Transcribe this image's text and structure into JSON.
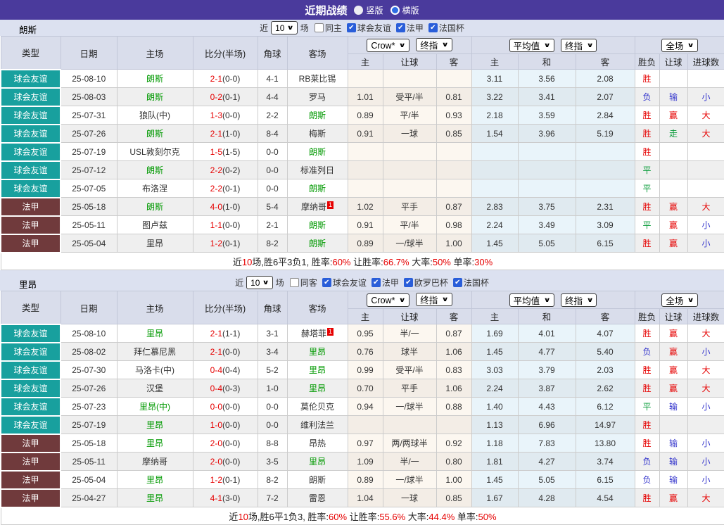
{
  "title_bar": {
    "title": "近期战绩",
    "radios": [
      {
        "label": "竖版",
        "checked": false
      },
      {
        "label": "横版",
        "checked": true
      }
    ]
  },
  "colors": {
    "titlebar_bg": "#4a3a9c",
    "friendly_badge_bg": "#18a09e",
    "league_badge_bg": "#703a3c",
    "self_team_green": "#009900",
    "score_red": "#e60000",
    "win_red": "#e60000",
    "draw_green": "#009933",
    "lose_blue": "#3334cc",
    "checkbox_blue": "#2a5ed9",
    "header_bg": "#d9ddeb",
    "avg_col_bg": "#e9f4fa",
    "odds_col_bg": "#fcf7f0"
  },
  "table_header": {
    "cols": [
      "类型",
      "日期",
      "主场",
      "比分(半场)",
      "角球",
      "客场"
    ],
    "odds_group": {
      "select1": "Crow*",
      "select2": "终指",
      "cols": [
        "主",
        "让球",
        "客"
      ]
    },
    "avg_group": {
      "select1": "平均值",
      "select2": "终指",
      "cols": [
        "主",
        "和",
        "客"
      ]
    },
    "result_group": {
      "select": "全场",
      "cols": [
        "胜负",
        "让球",
        "进球数"
      ]
    }
  },
  "sections": [
    {
      "team": "朗斯",
      "filter": {
        "near_label": "近",
        "matches": "10",
        "games_label": "场",
        "checkboxes": [
          {
            "label": "同主",
            "checked": false
          },
          {
            "label": "球会友谊",
            "checked": true
          },
          {
            "label": "法甲",
            "checked": true
          },
          {
            "label": "法国杯",
            "checked": true
          }
        ]
      },
      "rows": [
        {
          "type": "球会友谊",
          "style": "friendly",
          "date": "25-08-10",
          "home": "朗斯",
          "home_self": true,
          "home_sup": "",
          "score": "2-1",
          "half": "(0-0)",
          "corner": "4-1",
          "away": "RB莱比锡",
          "away_self": false,
          "away_sup": "",
          "odds": [
            "",
            "",
            ""
          ],
          "avg": [
            "3.11",
            "3.56",
            "2.08"
          ],
          "res": [
            {
              "t": "胜",
              "c": "red"
            },
            {
              "t": "",
              "c": ""
            },
            {
              "t": "",
              "c": ""
            }
          ]
        },
        {
          "type": "球会友谊",
          "style": "friendly",
          "date": "25-08-03",
          "home": "朗斯",
          "home_self": true,
          "home_sup": "",
          "score": "0-2",
          "half": "(0-1)",
          "corner": "4-4",
          "away": "罗马",
          "away_self": false,
          "away_sup": "",
          "odds": [
            "1.01",
            "受平/半",
            "0.81"
          ],
          "avg": [
            "3.22",
            "3.41",
            "2.07"
          ],
          "res": [
            {
              "t": "负",
              "c": "blue"
            },
            {
              "t": "输",
              "c": "blue"
            },
            {
              "t": "小",
              "c": "blue"
            }
          ]
        },
        {
          "type": "球会友谊",
          "style": "friendly",
          "date": "25-07-31",
          "home": "狼队(中)",
          "home_self": false,
          "home_sup": "",
          "score": "1-3",
          "half": "(0-0)",
          "corner": "2-2",
          "away": "朗斯",
          "away_self": true,
          "away_sup": "",
          "odds": [
            "0.89",
            "平/半",
            "0.93"
          ],
          "avg": [
            "2.18",
            "3.59",
            "2.84"
          ],
          "res": [
            {
              "t": "胜",
              "c": "red"
            },
            {
              "t": "赢",
              "c": "red"
            },
            {
              "t": "大",
              "c": "red"
            }
          ]
        },
        {
          "type": "球会友谊",
          "style": "friendly",
          "date": "25-07-26",
          "home": "朗斯",
          "home_self": true,
          "home_sup": "",
          "score": "2-1",
          "half": "(1-0)",
          "corner": "8-4",
          "away": "梅斯",
          "away_self": false,
          "away_sup": "",
          "odds": [
            "0.91",
            "一球",
            "0.85"
          ],
          "avg": [
            "1.54",
            "3.96",
            "5.19"
          ],
          "res": [
            {
              "t": "胜",
              "c": "red"
            },
            {
              "t": "走",
              "c": "green"
            },
            {
              "t": "大",
              "c": "red"
            }
          ]
        },
        {
          "type": "球会友谊",
          "style": "friendly",
          "date": "25-07-19",
          "home": "USL敦刻尔克",
          "home_self": false,
          "home_sup": "",
          "score": "1-5",
          "half": "(1-5)",
          "corner": "0-0",
          "away": "朗斯",
          "away_self": true,
          "away_sup": "",
          "odds": [
            "",
            "",
            ""
          ],
          "avg": [
            "",
            "",
            ""
          ],
          "res": [
            {
              "t": "胜",
              "c": "red"
            },
            {
              "t": "",
              "c": ""
            },
            {
              "t": "",
              "c": ""
            }
          ]
        },
        {
          "type": "球会友谊",
          "style": "friendly",
          "date": "25-07-12",
          "home": "朗斯",
          "home_self": true,
          "home_sup": "",
          "score": "2-2",
          "half": "(0-2)",
          "corner": "0-0",
          "away": "标准列日",
          "away_self": false,
          "away_sup": "",
          "odds": [
            "",
            "",
            ""
          ],
          "avg": [
            "",
            "",
            ""
          ],
          "res": [
            {
              "t": "平",
              "c": "green"
            },
            {
              "t": "",
              "c": ""
            },
            {
              "t": "",
              "c": ""
            }
          ]
        },
        {
          "type": "球会友谊",
          "style": "friendly",
          "date": "25-07-05",
          "home": "布洛涅",
          "home_self": false,
          "home_sup": "",
          "score": "2-2",
          "half": "(0-1)",
          "corner": "0-0",
          "away": "朗斯",
          "away_self": true,
          "away_sup": "",
          "odds": [
            "",
            "",
            ""
          ],
          "avg": [
            "",
            "",
            ""
          ],
          "res": [
            {
              "t": "平",
              "c": "green"
            },
            {
              "t": "",
              "c": ""
            },
            {
              "t": "",
              "c": ""
            }
          ]
        },
        {
          "type": "法甲",
          "style": "league",
          "date": "25-05-18",
          "home": "朗斯",
          "home_self": true,
          "home_sup": "",
          "score": "4-0",
          "half": "(1-0)",
          "corner": "5-4",
          "away": "摩纳哥",
          "away_self": false,
          "away_sup": "1",
          "odds": [
            "1.02",
            "平手",
            "0.87"
          ],
          "avg": [
            "2.83",
            "3.75",
            "2.31"
          ],
          "res": [
            {
              "t": "胜",
              "c": "red"
            },
            {
              "t": "赢",
              "c": "red"
            },
            {
              "t": "大",
              "c": "red"
            }
          ]
        },
        {
          "type": "法甲",
          "style": "league",
          "date": "25-05-11",
          "home": "图卢兹",
          "home_self": false,
          "home_sup": "",
          "score": "1-1",
          "half": "(0-0)",
          "corner": "2-1",
          "away": "朗斯",
          "away_self": true,
          "away_sup": "",
          "odds": [
            "0.91",
            "平/半",
            "0.98"
          ],
          "avg": [
            "2.24",
            "3.49",
            "3.09"
          ],
          "res": [
            {
              "t": "平",
              "c": "green"
            },
            {
              "t": "赢",
              "c": "red"
            },
            {
              "t": "小",
              "c": "blue"
            }
          ]
        },
        {
          "type": "法甲",
          "style": "league",
          "date": "25-05-04",
          "home": "里昂",
          "home_self": false,
          "home_sup": "",
          "score": "1-2",
          "half": "(0-1)",
          "corner": "8-2",
          "away": "朗斯",
          "away_self": true,
          "away_sup": "",
          "odds": [
            "0.89",
            "一/球半",
            "1.00"
          ],
          "avg": [
            "1.45",
            "5.05",
            "6.15"
          ],
          "res": [
            {
              "t": "胜",
              "c": "red"
            },
            {
              "t": "赢",
              "c": "red"
            },
            {
              "t": "小",
              "c": "blue"
            }
          ]
        }
      ],
      "summary": {
        "segments": [
          {
            "text": "近",
            "red": false
          },
          {
            "text": "10",
            "red": true
          },
          {
            "text": "场,胜6平3负1, 胜率:",
            "red": false
          },
          {
            "text": "60%",
            "red": true
          },
          {
            "text": " 让胜率:",
            "red": false
          },
          {
            "text": "66.7%",
            "red": true
          },
          {
            "text": " 大率:",
            "red": false
          },
          {
            "text": "50%",
            "red": true
          },
          {
            "text": " 单率:",
            "red": false
          },
          {
            "text": "30%",
            "red": true
          }
        ]
      }
    },
    {
      "team": "里昂",
      "filter": {
        "near_label": "近",
        "matches": "10",
        "games_label": "场",
        "checkboxes": [
          {
            "label": "同客",
            "checked": false
          },
          {
            "label": "球会友谊",
            "checked": true
          },
          {
            "label": "法甲",
            "checked": true
          },
          {
            "label": "欧罗巴杯",
            "checked": true
          },
          {
            "label": "法国杯",
            "checked": true
          }
        ]
      },
      "rows": [
        {
          "type": "球会友谊",
          "style": "friendly",
          "date": "25-08-10",
          "home": "里昂",
          "home_self": true,
          "home_sup": "",
          "score": "2-1",
          "half": "(1-1)",
          "corner": "3-1",
          "away": "赫塔菲",
          "away_self": false,
          "away_sup": "1",
          "odds": [
            "0.95",
            "半/一",
            "0.87"
          ],
          "avg": [
            "1.69",
            "4.01",
            "4.07"
          ],
          "res": [
            {
              "t": "胜",
              "c": "red"
            },
            {
              "t": "赢",
              "c": "red"
            },
            {
              "t": "大",
              "c": "red"
            }
          ]
        },
        {
          "type": "球会友谊",
          "style": "friendly",
          "date": "25-08-02",
          "home": "拜仁慕尼黑",
          "home_self": false,
          "home_sup": "",
          "score": "2-1",
          "half": "(0-0)",
          "corner": "3-4",
          "away": "里昂",
          "away_self": true,
          "away_sup": "",
          "odds": [
            "0.76",
            "球半",
            "1.06"
          ],
          "avg": [
            "1.45",
            "4.77",
            "5.40"
          ],
          "res": [
            {
              "t": "负",
              "c": "blue"
            },
            {
              "t": "赢",
              "c": "red"
            },
            {
              "t": "小",
              "c": "blue"
            }
          ]
        },
        {
          "type": "球会友谊",
          "style": "friendly",
          "date": "25-07-30",
          "home": "马洛卡(中)",
          "home_self": false,
          "home_sup": "",
          "score": "0-4",
          "half": "(0-4)",
          "corner": "5-2",
          "away": "里昂",
          "away_self": true,
          "away_sup": "",
          "odds": [
            "0.99",
            "受平/半",
            "0.83"
          ],
          "avg": [
            "3.03",
            "3.79",
            "2.03"
          ],
          "res": [
            {
              "t": "胜",
              "c": "red"
            },
            {
              "t": "赢",
              "c": "red"
            },
            {
              "t": "大",
              "c": "red"
            }
          ]
        },
        {
          "type": "球会友谊",
          "style": "friendly",
          "date": "25-07-26",
          "home": "汉堡",
          "home_self": false,
          "home_sup": "",
          "score": "0-4",
          "half": "(0-3)",
          "corner": "1-0",
          "away": "里昂",
          "away_self": true,
          "away_sup": "",
          "odds": [
            "0.70",
            "平手",
            "1.06"
          ],
          "avg": [
            "2.24",
            "3.87",
            "2.62"
          ],
          "res": [
            {
              "t": "胜",
              "c": "red"
            },
            {
              "t": "赢",
              "c": "red"
            },
            {
              "t": "大",
              "c": "red"
            }
          ]
        },
        {
          "type": "球会友谊",
          "style": "friendly",
          "date": "25-07-23",
          "home": "里昂(中)",
          "home_self": true,
          "home_sup": "",
          "score": "0-0",
          "half": "(0-0)",
          "corner": "0-0",
          "away": "莫伦贝克",
          "away_self": false,
          "away_sup": "",
          "odds": [
            "0.94",
            "一/球半",
            "0.88"
          ],
          "avg": [
            "1.40",
            "4.43",
            "6.12"
          ],
          "res": [
            {
              "t": "平",
              "c": "green"
            },
            {
              "t": "输",
              "c": "blue"
            },
            {
              "t": "小",
              "c": "blue"
            }
          ]
        },
        {
          "type": "球会友谊",
          "style": "friendly",
          "date": "25-07-19",
          "home": "里昂",
          "home_self": true,
          "home_sup": "",
          "score": "1-0",
          "half": "(0-0)",
          "corner": "0-0",
          "away": "维利法兰",
          "away_self": false,
          "away_sup": "",
          "odds": [
            "",
            "",
            ""
          ],
          "avg": [
            "1.13",
            "6.96",
            "14.97"
          ],
          "res": [
            {
              "t": "胜",
              "c": "red"
            },
            {
              "t": "",
              "c": ""
            },
            {
              "t": "",
              "c": ""
            }
          ]
        },
        {
          "type": "法甲",
          "style": "league",
          "date": "25-05-18",
          "home": "里昂",
          "home_self": true,
          "home_sup": "",
          "score": "2-0",
          "half": "(0-0)",
          "corner": "8-8",
          "away": "昂热",
          "away_self": false,
          "away_sup": "",
          "odds": [
            "0.97",
            "两/两球半",
            "0.92"
          ],
          "avg": [
            "1.18",
            "7.83",
            "13.80"
          ],
          "res": [
            {
              "t": "胜",
              "c": "red"
            },
            {
              "t": "输",
              "c": "blue"
            },
            {
              "t": "小",
              "c": "blue"
            }
          ]
        },
        {
          "type": "法甲",
          "style": "league",
          "date": "25-05-11",
          "home": "摩纳哥",
          "home_self": false,
          "home_sup": "",
          "score": "2-0",
          "half": "(0-0)",
          "corner": "3-5",
          "away": "里昂",
          "away_self": true,
          "away_sup": "",
          "odds": [
            "1.09",
            "半/一",
            "0.80"
          ],
          "avg": [
            "1.81",
            "4.27",
            "3.74"
          ],
          "res": [
            {
              "t": "负",
              "c": "blue"
            },
            {
              "t": "输",
              "c": "blue"
            },
            {
              "t": "小",
              "c": "blue"
            }
          ]
        },
        {
          "type": "法甲",
          "style": "league",
          "date": "25-05-04",
          "home": "里昂",
          "home_self": true,
          "home_sup": "",
          "score": "1-2",
          "half": "(0-1)",
          "corner": "8-2",
          "away": "朗斯",
          "away_self": false,
          "away_sup": "",
          "odds": [
            "0.89",
            "一/球半",
            "1.00"
          ],
          "avg": [
            "1.45",
            "5.05",
            "6.15"
          ],
          "res": [
            {
              "t": "负",
              "c": "blue"
            },
            {
              "t": "输",
              "c": "blue"
            },
            {
              "t": "小",
              "c": "blue"
            }
          ]
        },
        {
          "type": "法甲",
          "style": "league",
          "date": "25-04-27",
          "home": "里昂",
          "home_self": true,
          "home_sup": "",
          "score": "4-1",
          "half": "(3-0)",
          "corner": "7-2",
          "away": "雷恩",
          "away_self": false,
          "away_sup": "",
          "odds": [
            "1.04",
            "一球",
            "0.85"
          ],
          "avg": [
            "1.67",
            "4.28",
            "4.54"
          ],
          "res": [
            {
              "t": "胜",
              "c": "red"
            },
            {
              "t": "赢",
              "c": "red"
            },
            {
              "t": "大",
              "c": "red"
            }
          ]
        }
      ],
      "summary": {
        "segments": [
          {
            "text": "近",
            "red": false
          },
          {
            "text": "10",
            "red": true
          },
          {
            "text": "场,胜6平1负3, 胜率:",
            "red": false
          },
          {
            "text": "60%",
            "red": true
          },
          {
            "text": " 让胜率:",
            "red": false
          },
          {
            "text": "55.6%",
            "red": true
          },
          {
            "text": " 大率:",
            "red": false
          },
          {
            "text": "44.4%",
            "red": true
          },
          {
            "text": " 单率:",
            "red": false
          },
          {
            "text": "50%",
            "red": true
          }
        ]
      }
    }
  ]
}
